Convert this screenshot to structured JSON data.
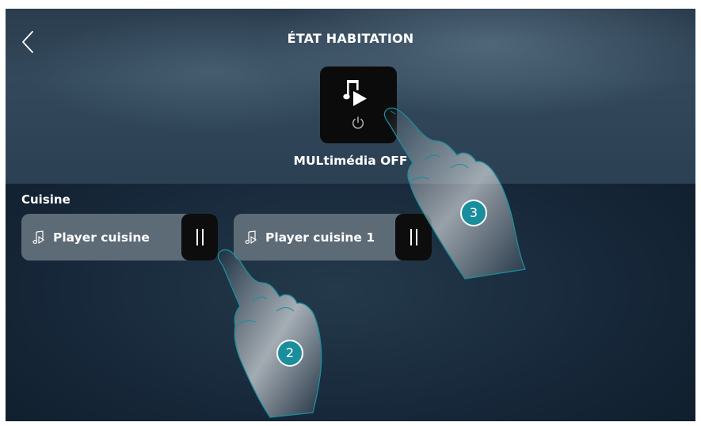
{
  "header": {
    "title": "ÉTAT HABITATION",
    "back_icon": "chevron-left-icon"
  },
  "multimedia_tile": {
    "label": "MULtimédia OFF",
    "icons": [
      "music-play-icon",
      "power-icon"
    ]
  },
  "section": {
    "title": "Cuisine"
  },
  "players": [
    {
      "name": "Player cuisine",
      "icon": "music-note-icon",
      "control_icon": "pause-icon"
    },
    {
      "name": "Player cuisine 1",
      "icon": "music-note-icon",
      "control_icon": "pause-icon"
    }
  ],
  "annotations": {
    "step_2": "2",
    "step_3": "3",
    "badge_color": "#1a8e9c"
  },
  "colors": {
    "header_bg": "#33495b",
    "body_bg": "#17283a",
    "player_bg": "#5d6b77",
    "control_bg": "#0d0d0e",
    "tile_bg": "#0b0b0c"
  }
}
